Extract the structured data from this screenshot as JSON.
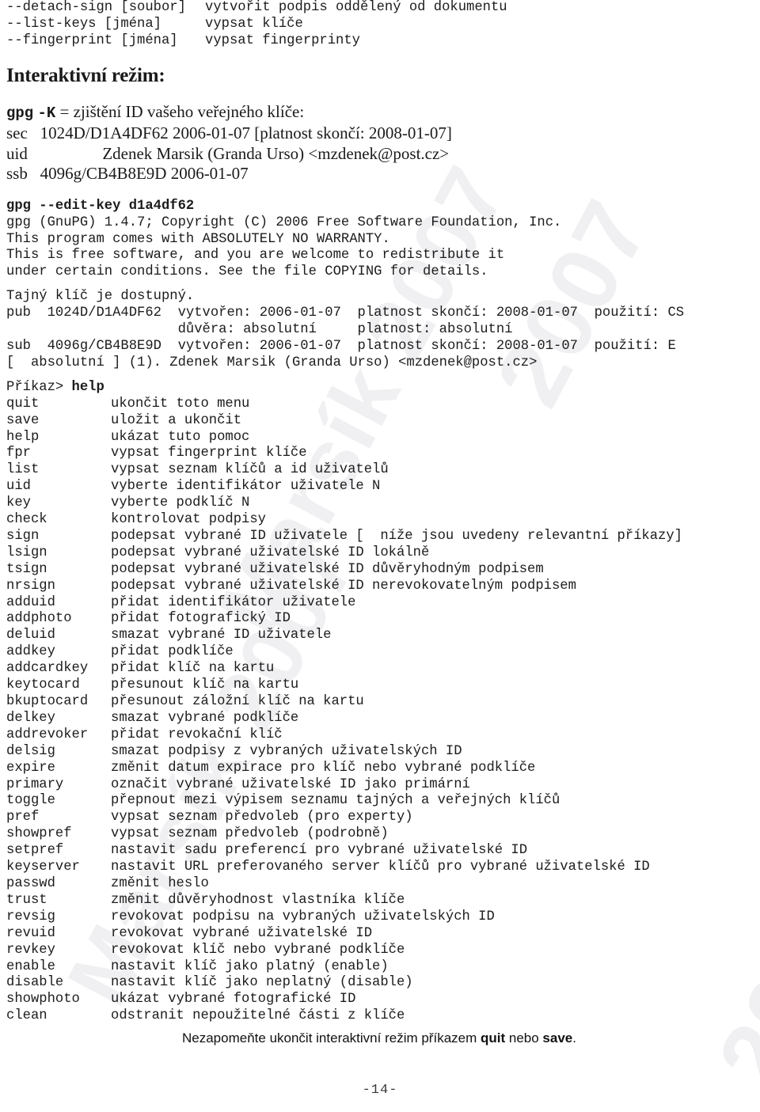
{
  "document": {
    "page_number": "-14-"
  },
  "watermark": {
    "text_year": "2007",
    "text_name": "Marsík 2007",
    "color": "#f0f0f2"
  },
  "top_options": [
    {
      "option": "--detach-sign [soubor]",
      "description": "vytvořit podpis oddělený od dokumentu"
    },
    {
      "option": "--list-keys [jména]",
      "description": "vypsat klíče"
    },
    {
      "option": "--fingerprint [jména]",
      "description": "vypsat fingerprinty"
    }
  ],
  "section": {
    "heading": "Interaktivní režim:"
  },
  "list_keys_example": {
    "command_prefix": "gpg",
    "command_flag": "-K",
    "command_caption": " = zjištění ID vašeho veřejného klíče:",
    "lines": [
      "sec   1024D/D1A4DF62 2006-01-07 [platnost skončí: 2008-01-07]",
      "uid                  Zdenek Marsik (Granda Urso) <mzdenek@post.cz>",
      "ssb   4096g/CB4B8E9D 2006-01-07"
    ]
  },
  "edit_key_session": {
    "command": "gpg --edit-key d1a4df62",
    "banner": [
      "gpg (GnuPG) 1.4.7; Copyright (C) 2006 Free Software Foundation, Inc.",
      "This program comes with ABSOLUTELY NO WARRANTY.",
      "This is free software, and you are welcome to redistribute it",
      "under certain conditions. See the file COPYING for details."
    ],
    "status": [
      "Tajný klíč je dostupný.",
      "pub  1024D/D1A4DF62  vytvořen: 2006-01-07  platnost skončí: 2008-01-07  použití: CS",
      "                     důvěra: absolutní     platnost: absolutní",
      "sub  4096g/CB4B8E9D  vytvořen: 2006-01-07  platnost skončí: 2008-01-07  použití: E",
      "[  absolutní ] (1). Zdenek Marsik (Granda Urso) <mzdenek@post.cz>"
    ],
    "prompt_label": "Příkaz> ",
    "prompt_command": "help"
  },
  "help_commands": [
    {
      "name": "quit",
      "description": "ukončit toto menu"
    },
    {
      "name": "save",
      "description": "uložit a ukončit"
    },
    {
      "name": "help",
      "description": "ukázat tuto pomoc"
    },
    {
      "name": "fpr",
      "description": "vypsat fingerprint klíče"
    },
    {
      "name": "list",
      "description": "vypsat seznam klíčů a id uživatelů"
    },
    {
      "name": "uid",
      "description": "vyberte identifikátor uživatele N"
    },
    {
      "name": "key",
      "description": "vyberte podklíč N"
    },
    {
      "name": "check",
      "description": "kontrolovat podpisy"
    },
    {
      "name": "sign",
      "description": "podepsat vybrané ID uživatele [  níže jsou uvedeny relevantní příkazy]"
    },
    {
      "name": "lsign",
      "description": "podepsat vybrané uživatelské ID lokálně"
    },
    {
      "name": "tsign",
      "description": "podepsat vybrané uživatelské ID důvěryhodným podpisem"
    },
    {
      "name": "nrsign",
      "description": "podepsat vybrané uživatelské ID nerevokovatelným podpisem"
    },
    {
      "name": "adduid",
      "description": "přidat identifikátor uživatele"
    },
    {
      "name": "addphoto",
      "description": "přidat fotografický ID"
    },
    {
      "name": "deluid",
      "description": "smazat vybrané ID uživatele"
    },
    {
      "name": "addkey",
      "description": "přidat podklíče"
    },
    {
      "name": "addcardkey",
      "description": "přidat klíč na kartu"
    },
    {
      "name": "keytocard",
      "description": "přesunout klíč na kartu"
    },
    {
      "name": "bkuptocard",
      "description": "přesunout záložní klíč na kartu"
    },
    {
      "name": "delkey",
      "description": "smazat vybrané podklíče"
    },
    {
      "name": "addrevoker",
      "description": "přidat revokační klíč"
    },
    {
      "name": "delsig",
      "description": "smazat podpisy z vybraných uživatelských ID"
    },
    {
      "name": "expire",
      "description": "změnit datum expirace pro klíč nebo vybrané podklíče"
    },
    {
      "name": "primary",
      "description": "označit vybrané uživatelské ID jako primární"
    },
    {
      "name": "toggle",
      "description": "přepnout mezi výpisem seznamu tajných a veřejných klíčů"
    },
    {
      "name": "pref",
      "description": "vypsat seznam předvoleb (pro experty)"
    },
    {
      "name": "showpref",
      "description": "vypsat seznam předvoleb (podrobně)"
    },
    {
      "name": "setpref",
      "description": "nastavit sadu preferencí pro vybrané uživatelské ID"
    },
    {
      "name": "keyserver",
      "description": "nastavit URL preferovaného server klíčů pro vybrané uživatelské ID"
    },
    {
      "name": "passwd",
      "description": "změnit heslo"
    },
    {
      "name": "trust",
      "description": "změnit důvěryhodnost vlastníka klíče"
    },
    {
      "name": "revsig",
      "description": "revokovat podpisu na vybraných uživatelských ID"
    },
    {
      "name": "revuid",
      "description": "revokovat vybrané uživatelské ID"
    },
    {
      "name": "revkey",
      "description": "revokovat klíč nebo vybrané podklíče"
    },
    {
      "name": "enable",
      "description": "nastavit klíč jako platný (enable)"
    },
    {
      "name": "disable",
      "description": "nastavit klíč jako neplatný (disable)"
    },
    {
      "name": "showphoto",
      "description": "ukázat vybrané fotografické ID"
    },
    {
      "name": "clean",
      "description": "odstranit nepoužitelné části z klíče"
    }
  ],
  "footer_note": {
    "prefix": "Nezapomeňte ukončit interaktivní režim příkazem ",
    "bold_1": "quit",
    "middle": " nebo ",
    "bold_2": "save",
    "suffix": "."
  }
}
